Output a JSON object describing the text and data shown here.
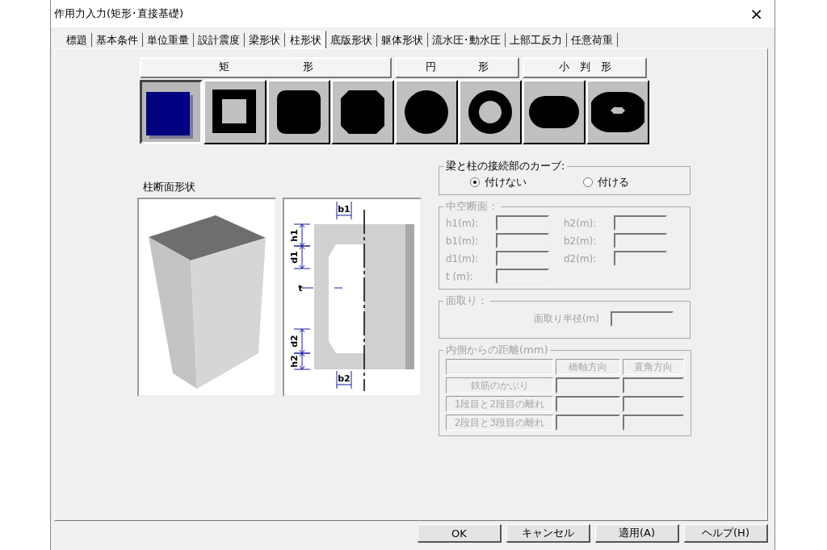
{
  "window": {
    "title": "作用力入力(矩形･直接基礎)",
    "close": "×"
  },
  "tabs": [
    {
      "label": "標題",
      "selected": false
    },
    {
      "label": "基本条件",
      "selected": false
    },
    {
      "label": "単位重量",
      "selected": false
    },
    {
      "label": "設計震度",
      "selected": false
    },
    {
      "label": "梁形状",
      "selected": false
    },
    {
      "label": "柱形状",
      "selected": true
    },
    {
      "label": "底版形状",
      "selected": false
    },
    {
      "label": "躯体形状",
      "selected": false
    },
    {
      "label": "流水圧･動水圧",
      "selected": false
    },
    {
      "label": "上部工反力",
      "selected": false
    },
    {
      "label": "任意荷重",
      "selected": false
    }
  ],
  "shape_groups": [
    {
      "label": "矩　　　　　　　形",
      "shapes": [
        {
          "kind": "rect",
          "selected": true
        },
        {
          "kind": "rect-hollow",
          "selected": false
        },
        {
          "kind": "rounded",
          "selected": false
        },
        {
          "kind": "octagon",
          "selected": false
        }
      ]
    },
    {
      "label": "円　　　　形",
      "shapes": [
        {
          "kind": "circle",
          "selected": false
        },
        {
          "kind": "ring",
          "selected": false
        }
      ]
    },
    {
      "label": "小　判　形",
      "shapes": [
        {
          "kind": "oval",
          "selected": false
        },
        {
          "kind": "oval-hollow",
          "selected": false
        }
      ]
    }
  ],
  "section_view": {
    "label": "柱断面形状",
    "diagram_labels": [
      "b1",
      "h1",
      "d1",
      "t",
      "d2",
      "h2",
      "b2"
    ]
  },
  "curve": {
    "title": "梁と柱の接続部のカーブ:",
    "disabled": false,
    "options": [
      {
        "label": "付けない",
        "selected": true
      },
      {
        "label": "付ける",
        "selected": false
      }
    ]
  },
  "hollow": {
    "title": "中空断面：",
    "disabled": true,
    "fields": [
      {
        "label": "h1(m):"
      },
      {
        "label": "h2(m):"
      },
      {
        "label": "b1(m):"
      },
      {
        "label": "b2(m):"
      },
      {
        "label": "d1(m):"
      },
      {
        "label": "d2(m):"
      },
      {
        "label": "t (m):"
      }
    ]
  },
  "chamfer": {
    "title": "面取り：",
    "disabled": true,
    "field_label": "面取り半径(m)"
  },
  "distance": {
    "title": "内側からの距離(mm)",
    "disabled": true,
    "columns": [
      "橋軸方向",
      "直角方向"
    ],
    "rows": [
      "鉄筋のかぶり",
      "1段目と2段目の離れ",
      "2段目と3段目の離れ"
    ]
  },
  "buttons": [
    "OK",
    "キャンセル",
    "適用(A)",
    "ヘルプ(H)"
  ]
}
